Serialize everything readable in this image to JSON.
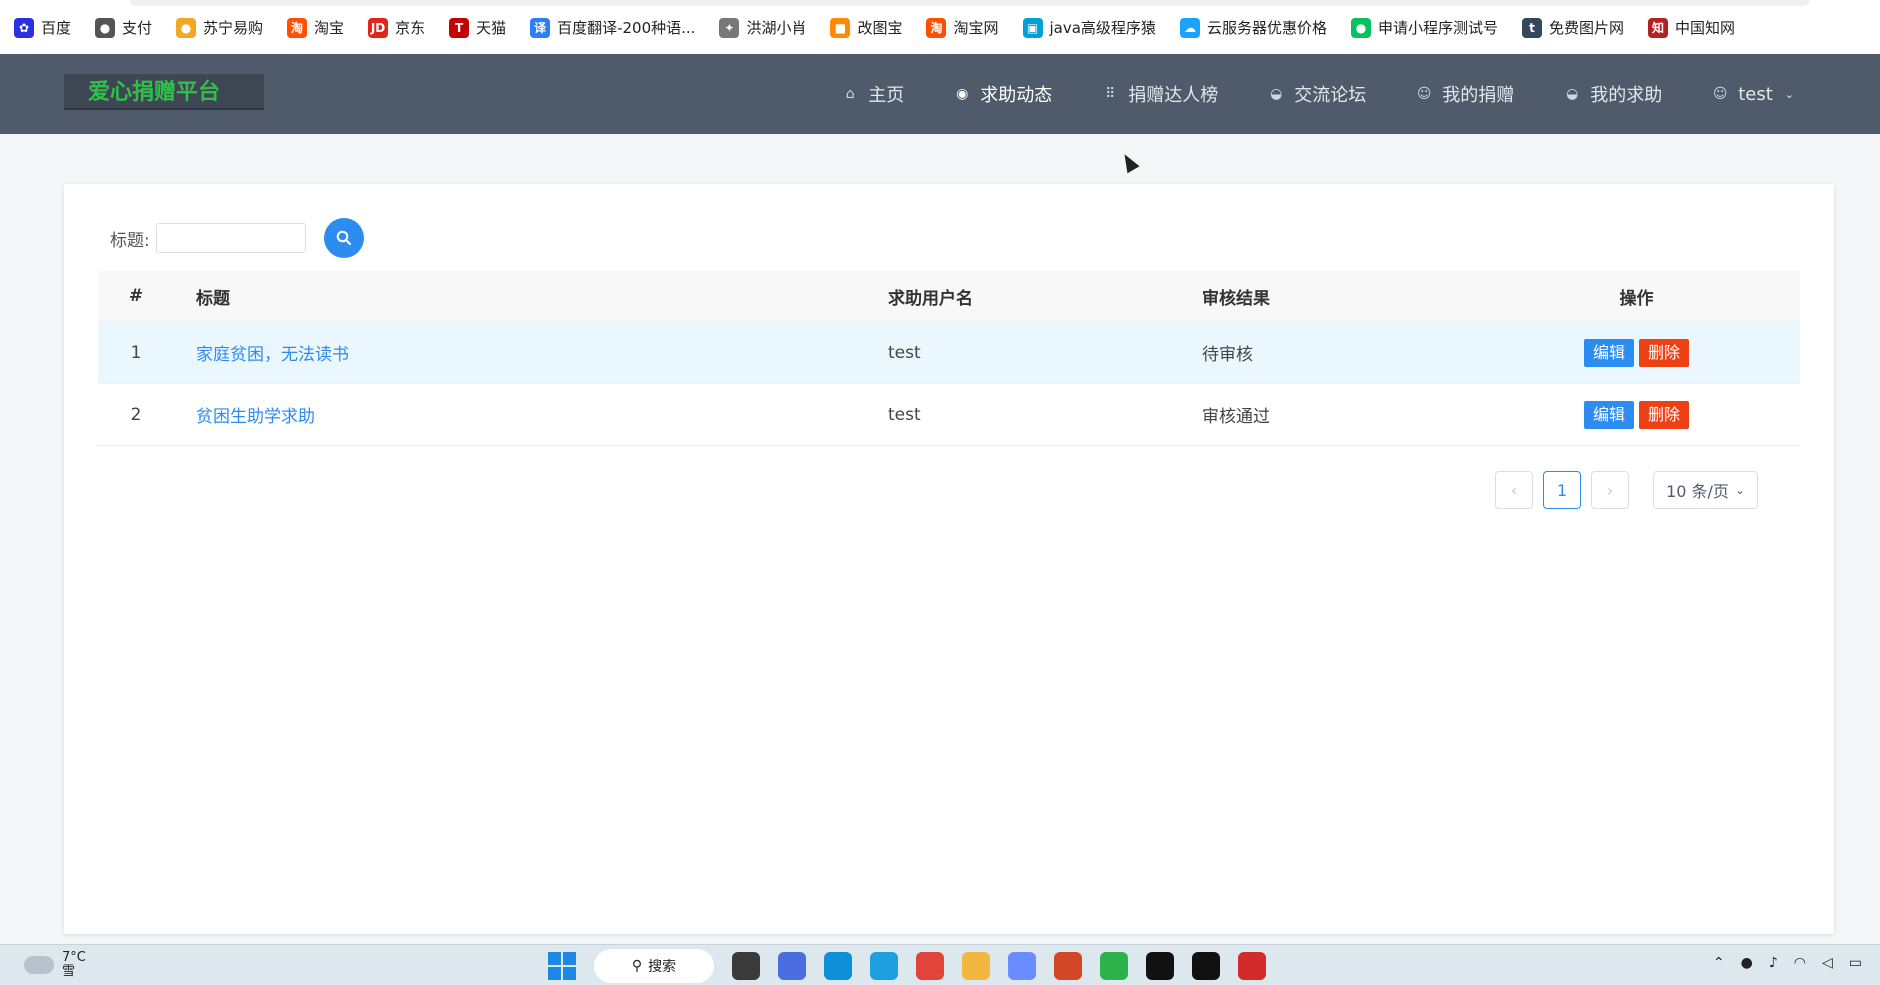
{
  "bookmarks": [
    {
      "label": "百度",
      "icon": "baidu-icon",
      "color": "#2932e1",
      "glyph": "✿"
    },
    {
      "label": "支付",
      "icon": "globe-icon",
      "color": "#555555",
      "glyph": "●"
    },
    {
      "label": "苏宁易购",
      "icon": "suning-icon",
      "color": "#f5a623",
      "glyph": "●"
    },
    {
      "label": "淘宝",
      "icon": "taobao-icon",
      "color": "#ff5000",
      "glyph": "淘"
    },
    {
      "label": "京东",
      "icon": "jd-icon",
      "color": "#e1251b",
      "glyph": "JD"
    },
    {
      "label": "天猫",
      "icon": "tmall-icon",
      "color": "#c40000",
      "glyph": "T"
    },
    {
      "label": "百度翻译-200种语...",
      "icon": "translate-icon",
      "color": "#2d7df6",
      "glyph": "译"
    },
    {
      "label": "洪湖小肖",
      "icon": "bird-icon",
      "color": "#777777",
      "glyph": "✦"
    },
    {
      "label": "改图宝",
      "icon": "gaitubao-icon",
      "color": "#ff8a00",
      "glyph": "■"
    },
    {
      "label": "淘宝网",
      "icon": "taobao-icon",
      "color": "#ff5000",
      "glyph": "淘"
    },
    {
      "label": "java高级程序猿",
      "icon": "bilibili-icon",
      "color": "#00a1d6",
      "glyph": "▣"
    },
    {
      "label": "云服务器优惠价格",
      "icon": "cloud-icon",
      "color": "#1aa3ff",
      "glyph": "☁"
    },
    {
      "label": "申请小程序测试号",
      "icon": "wechat-icon",
      "color": "#07c160",
      "glyph": "●"
    },
    {
      "label": "免费图片网",
      "icon": "tumblr-icon",
      "color": "#36465d",
      "glyph": "t"
    },
    {
      "label": "中国知网",
      "icon": "cnki-icon",
      "color": "#b22222",
      "glyph": "知"
    }
  ],
  "header": {
    "logo": "爱心捐赠平台",
    "nav": [
      {
        "label": "主页",
        "icon": "home-icon",
        "glyph": "⌂",
        "active": false
      },
      {
        "label": "求助动态",
        "icon": "compass-icon",
        "glyph": "◉",
        "active": true
      },
      {
        "label": "捐赠达人榜",
        "icon": "grid-icon",
        "glyph": "⠿",
        "active": false
      },
      {
        "label": "交流论坛",
        "icon": "chat-icon",
        "glyph": "◒",
        "active": false
      },
      {
        "label": "我的捐赠",
        "icon": "smile-icon",
        "glyph": "☺",
        "active": false
      },
      {
        "label": "我的求助",
        "icon": "help-icon",
        "glyph": "◒",
        "active": false
      }
    ],
    "user": {
      "label": "test",
      "icon": "user-icon",
      "glyph": "☺",
      "caret": "⌄"
    }
  },
  "search": {
    "label": "标题:",
    "value": "",
    "placeholder": ""
  },
  "table": {
    "columns": [
      "#",
      "标题",
      "求助用户名",
      "审核结果",
      "操作"
    ],
    "rows": [
      {
        "idx": "1",
        "title": "家庭贫困，无法读书",
        "user": "test",
        "status": "待审核",
        "highlight": true
      },
      {
        "idx": "2",
        "title": "贫困生助学求助",
        "user": "test",
        "status": "审核通过",
        "highlight": false
      }
    ],
    "edit_label": "编辑",
    "delete_label": "删除"
  },
  "pagination": {
    "prev": "‹",
    "current": "1",
    "next": "›",
    "page_size": "10 条/页"
  },
  "taskbar": {
    "temp": "7°C",
    "weather": "雪",
    "search_label": "搜索",
    "apps": [
      {
        "name": "task-view-icon",
        "color": "#3a3a3a"
      },
      {
        "name": "chat-app-icon",
        "color": "#4a6ee0"
      },
      {
        "name": "edge-icon",
        "color": "#0f8fd8"
      },
      {
        "name": "ie-icon",
        "color": "#1ea0e0"
      },
      {
        "name": "chrome-icon",
        "color": "#e0443a"
      },
      {
        "name": "folder-icon",
        "color": "#f3b63f"
      },
      {
        "name": "copilot-icon",
        "color": "#6a8cff"
      },
      {
        "name": "powerpoint-icon",
        "color": "#d24726"
      },
      {
        "name": "hbuilder-icon",
        "color": "#2bb34a"
      },
      {
        "name": "intellij-icon",
        "color": "#111111"
      },
      {
        "name": "terminal-icon",
        "color": "#111111"
      },
      {
        "name": "wps-icon",
        "color": "#d12b2b"
      }
    ]
  }
}
